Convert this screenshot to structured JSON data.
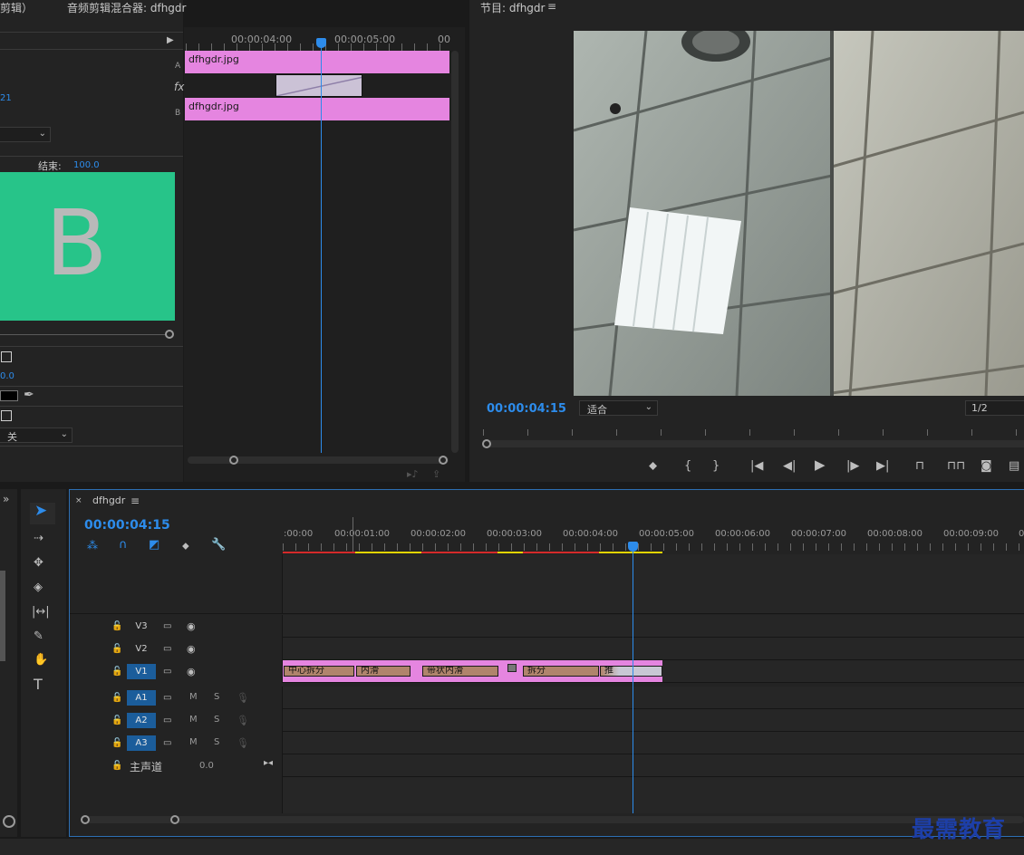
{
  "effect_controls": {
    "title": "剪辑）",
    "value_21": "21",
    "end_label": "结束:",
    "end_value": "100.0",
    "preview_letter": "B",
    "value_00": "0.0",
    "dropdown_value": "关"
  },
  "audio_mixer": {
    "title": "音频剪辑混合器: dfhgdr",
    "ruler_times": [
      "00:00:04:00",
      "00:00:05:00",
      "00"
    ],
    "track_a_label": "A",
    "track_b_label": "B",
    "clip_a": "dfhgdr.jpg",
    "clip_b": "dfhgdr.jpg",
    "fx_label": "fx"
  },
  "program_monitor": {
    "title": "节目: dfhgdr",
    "timecode": "00:00:04:15",
    "fit_label": "适合",
    "resolution": "1/2"
  },
  "timeline": {
    "sequence_name": "dfhgdr",
    "timecode": "00:00:04:15",
    "ruler_times": [
      ":00:00",
      "00:00:01:00",
      "00:00:02:00",
      "00:00:03:00",
      "00:00:04:00",
      "00:00:05:00",
      "00:00:06:00",
      "00:00:07:00",
      "00:00:08:00",
      "00:00:09:00",
      "0"
    ],
    "tracks": [
      {
        "name": "V3"
      },
      {
        "name": "V2"
      },
      {
        "name": "V1"
      },
      {
        "name": "A1",
        "m": "M",
        "s": "S"
      },
      {
        "name": "A2",
        "m": "M",
        "s": "S"
      },
      {
        "name": "A3",
        "m": "M",
        "s": "S"
      }
    ],
    "master_label": "主声道",
    "master_value": "0.0",
    "clips": [
      "中心拆分",
      "内滑",
      "带状内滑",
      "拆分",
      "推"
    ]
  },
  "watermark": "最需教育",
  "colors": {
    "accent": "#2d8ceb",
    "clip_pink": "#e585e0",
    "preview_green": "#27c489"
  }
}
